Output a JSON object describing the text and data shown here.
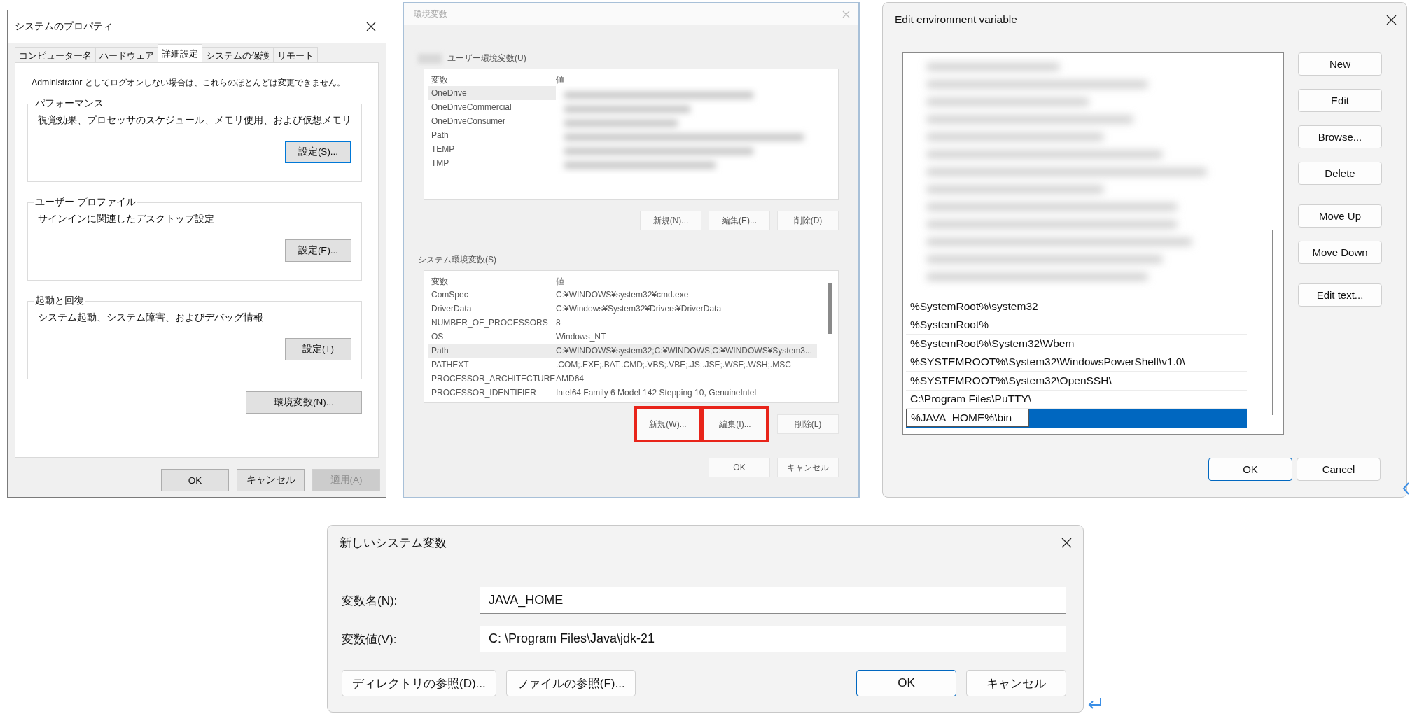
{
  "system_properties": {
    "title": "システムのプロパティ",
    "tabs": [
      {
        "label": "コンピューター名",
        "selected": false
      },
      {
        "label": "ハードウェア",
        "selected": false
      },
      {
        "label": "詳細設定",
        "selected": true
      },
      {
        "label": "システムの保護",
        "selected": false
      },
      {
        "label": "リモート",
        "selected": false
      }
    ],
    "notice": "Administrator としてログオンしない場合は、これらのほとんどは変更できません。",
    "groups": [
      {
        "title": "パフォーマンス",
        "description": "視覚効果、プロセッサのスケジュール、メモリ使用、および仮想メモリ",
        "button": "設定(S)...",
        "focused": true
      },
      {
        "title": "ユーザー プロファイル",
        "description": "サインインに関連したデスクトップ設定",
        "button": "設定(E)...",
        "focused": false
      },
      {
        "title": "起動と回復",
        "description": "システム起動、システム障害、およびデバッグ情報",
        "button": "設定(T)",
        "focused": false
      }
    ],
    "env_button": "環境変数(N)...",
    "buttons": [
      {
        "label": "OK",
        "disabled": false
      },
      {
        "label": "キャンセル",
        "disabled": false
      },
      {
        "label": "適用(A)",
        "disabled": true
      }
    ]
  },
  "environment_variables": {
    "title": "環境変数",
    "user_section": {
      "label": "ユーザー環境変数(U)",
      "columns": [
        "変数",
        "値"
      ],
      "rows": [
        {
          "name": "OneDrive",
          "selected": true
        },
        {
          "name": "OneDriveCommercial",
          "selected": false
        },
        {
          "name": "OneDriveConsumer",
          "selected": false
        },
        {
          "name": "Path",
          "selected": false
        },
        {
          "name": "TEMP",
          "selected": false
        },
        {
          "name": "TMP",
          "selected": false
        }
      ],
      "buttons": [
        {
          "label": "新規(N)...",
          "highlighted": false
        },
        {
          "label": "編集(E)...",
          "highlighted": false
        },
        {
          "label": "削除(D)",
          "highlighted": false
        }
      ]
    },
    "system_section": {
      "label": "システム環境変数(S)",
      "columns": [
        "変数",
        "値"
      ],
      "rows": [
        {
          "name": "ComSpec",
          "value": "C:¥WINDOWS¥system32¥cmd.exe",
          "selected": false
        },
        {
          "name": "DriverData",
          "value": "C:¥Windows¥System32¥Drivers¥DriverData",
          "selected": false
        },
        {
          "name": "NUMBER_OF_PROCESSORS",
          "value": "8",
          "selected": false
        },
        {
          "name": "OS",
          "value": "Windows_NT",
          "selected": false
        },
        {
          "name": "Path",
          "value": "C:¥WINDOWS¥system32;C:¥WINDOWS;C:¥WINDOWS¥System3...",
          "selected": true
        },
        {
          "name": "PATHEXT",
          "value": ".COM;.EXE;.BAT;.CMD;.VBS;.VBE;.JS;.JSE;.WSF;.WSH;.MSC",
          "selected": false
        },
        {
          "name": "PROCESSOR_ARCHITECTURE",
          "value": "AMD64",
          "selected": false
        },
        {
          "name": "PROCESSOR_IDENTIFIER",
          "value": "Intel64 Family 6 Model 142 Stepping 10, GenuineIntel",
          "selected": false
        }
      ],
      "buttons": [
        {
          "label": "新規(W)...",
          "highlighted": true
        },
        {
          "label": "編集(I)...",
          "highlighted": true
        },
        {
          "label": "削除(L)",
          "highlighted": false
        }
      ]
    },
    "buttons": [
      "OK",
      "キャンセル"
    ]
  },
  "edit_variable": {
    "title": "Edit environment variable",
    "entries": [
      {
        "text": "%SystemRoot%\\system32",
        "selected": false
      },
      {
        "text": "%SystemRoot%",
        "selected": false
      },
      {
        "text": "%SystemRoot%\\System32\\Wbem",
        "selected": false
      },
      {
        "text": "%SYSTEMROOT%\\System32\\WindowsPowerShell\\v1.0\\",
        "selected": false
      },
      {
        "text": "%SYSTEMROOT%\\System32\\OpenSSH\\",
        "selected": false
      },
      {
        "text": "C:\\Program Files\\PuTTY\\",
        "selected": false
      },
      {
        "text": "%JAVA_HOME%\\bin",
        "selected": true
      }
    ],
    "button_groups": [
      [
        "New",
        "Edit",
        "Browse...",
        "Delete"
      ],
      [
        "Move Up",
        "Move Down"
      ],
      [
        "Edit text..."
      ]
    ],
    "buttons": [
      {
        "label": "OK",
        "default": true
      },
      {
        "label": "Cancel",
        "default": false
      }
    ]
  },
  "new_variable": {
    "title": "新しいシステム変数",
    "fields": [
      {
        "label": "変数名(N):",
        "value": "JAVA_HOME"
      },
      {
        "label": "変数値(V):",
        "value": "C: \\Program Files\\Java\\jdk-21"
      }
    ],
    "browse_buttons": [
      "ディレクトリの参照(D)...",
      "ファイルの参照(F)..."
    ],
    "buttons": [
      {
        "label": "OK",
        "default": true
      },
      {
        "label": "キャンセル",
        "default": false
      }
    ]
  }
}
